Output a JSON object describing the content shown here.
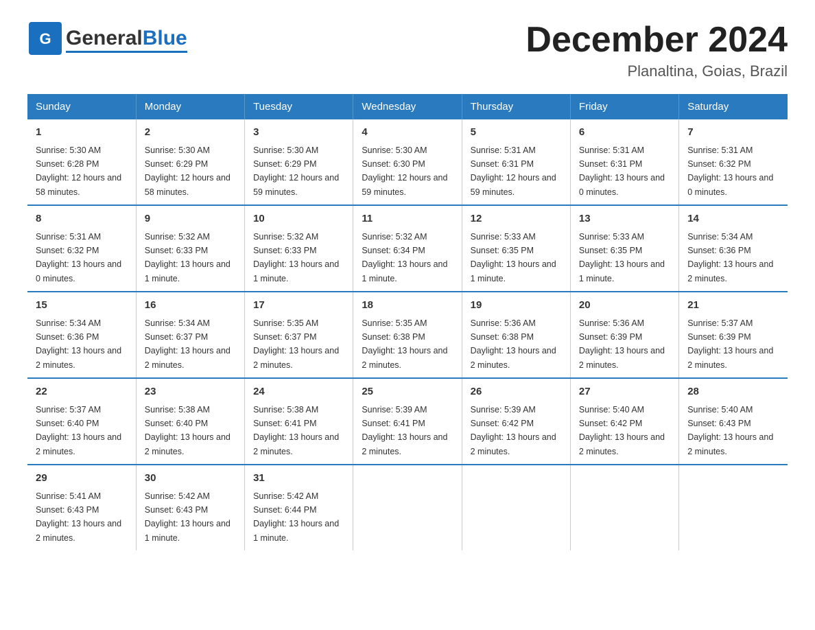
{
  "header": {
    "logo_text_general": "General",
    "logo_text_blue": "Blue",
    "title": "December 2024",
    "subtitle": "Planaltina, Goias, Brazil"
  },
  "days_of_week": [
    "Sunday",
    "Monday",
    "Tuesday",
    "Wednesday",
    "Thursday",
    "Friday",
    "Saturday"
  ],
  "weeks": [
    [
      {
        "day": "1",
        "sunrise": "5:30 AM",
        "sunset": "6:28 PM",
        "daylight": "12 hours and 58 minutes."
      },
      {
        "day": "2",
        "sunrise": "5:30 AM",
        "sunset": "6:29 PM",
        "daylight": "12 hours and 58 minutes."
      },
      {
        "day": "3",
        "sunrise": "5:30 AM",
        "sunset": "6:29 PM",
        "daylight": "12 hours and 59 minutes."
      },
      {
        "day": "4",
        "sunrise": "5:30 AM",
        "sunset": "6:30 PM",
        "daylight": "12 hours and 59 minutes."
      },
      {
        "day": "5",
        "sunrise": "5:31 AM",
        "sunset": "6:31 PM",
        "daylight": "12 hours and 59 minutes."
      },
      {
        "day": "6",
        "sunrise": "5:31 AM",
        "sunset": "6:31 PM",
        "daylight": "13 hours and 0 minutes."
      },
      {
        "day": "7",
        "sunrise": "5:31 AM",
        "sunset": "6:32 PM",
        "daylight": "13 hours and 0 minutes."
      }
    ],
    [
      {
        "day": "8",
        "sunrise": "5:31 AM",
        "sunset": "6:32 PM",
        "daylight": "13 hours and 0 minutes."
      },
      {
        "day": "9",
        "sunrise": "5:32 AM",
        "sunset": "6:33 PM",
        "daylight": "13 hours and 1 minute."
      },
      {
        "day": "10",
        "sunrise": "5:32 AM",
        "sunset": "6:33 PM",
        "daylight": "13 hours and 1 minute."
      },
      {
        "day": "11",
        "sunrise": "5:32 AM",
        "sunset": "6:34 PM",
        "daylight": "13 hours and 1 minute."
      },
      {
        "day": "12",
        "sunrise": "5:33 AM",
        "sunset": "6:35 PM",
        "daylight": "13 hours and 1 minute."
      },
      {
        "day": "13",
        "sunrise": "5:33 AM",
        "sunset": "6:35 PM",
        "daylight": "13 hours and 1 minute."
      },
      {
        "day": "14",
        "sunrise": "5:34 AM",
        "sunset": "6:36 PM",
        "daylight": "13 hours and 2 minutes."
      }
    ],
    [
      {
        "day": "15",
        "sunrise": "5:34 AM",
        "sunset": "6:36 PM",
        "daylight": "13 hours and 2 minutes."
      },
      {
        "day": "16",
        "sunrise": "5:34 AM",
        "sunset": "6:37 PM",
        "daylight": "13 hours and 2 minutes."
      },
      {
        "day": "17",
        "sunrise": "5:35 AM",
        "sunset": "6:37 PM",
        "daylight": "13 hours and 2 minutes."
      },
      {
        "day": "18",
        "sunrise": "5:35 AM",
        "sunset": "6:38 PM",
        "daylight": "13 hours and 2 minutes."
      },
      {
        "day": "19",
        "sunrise": "5:36 AM",
        "sunset": "6:38 PM",
        "daylight": "13 hours and 2 minutes."
      },
      {
        "day": "20",
        "sunrise": "5:36 AM",
        "sunset": "6:39 PM",
        "daylight": "13 hours and 2 minutes."
      },
      {
        "day": "21",
        "sunrise": "5:37 AM",
        "sunset": "6:39 PM",
        "daylight": "13 hours and 2 minutes."
      }
    ],
    [
      {
        "day": "22",
        "sunrise": "5:37 AM",
        "sunset": "6:40 PM",
        "daylight": "13 hours and 2 minutes."
      },
      {
        "day": "23",
        "sunrise": "5:38 AM",
        "sunset": "6:40 PM",
        "daylight": "13 hours and 2 minutes."
      },
      {
        "day": "24",
        "sunrise": "5:38 AM",
        "sunset": "6:41 PM",
        "daylight": "13 hours and 2 minutes."
      },
      {
        "day": "25",
        "sunrise": "5:39 AM",
        "sunset": "6:41 PM",
        "daylight": "13 hours and 2 minutes."
      },
      {
        "day": "26",
        "sunrise": "5:39 AM",
        "sunset": "6:42 PM",
        "daylight": "13 hours and 2 minutes."
      },
      {
        "day": "27",
        "sunrise": "5:40 AM",
        "sunset": "6:42 PM",
        "daylight": "13 hours and 2 minutes."
      },
      {
        "day": "28",
        "sunrise": "5:40 AM",
        "sunset": "6:43 PM",
        "daylight": "13 hours and 2 minutes."
      }
    ],
    [
      {
        "day": "29",
        "sunrise": "5:41 AM",
        "sunset": "6:43 PM",
        "daylight": "13 hours and 2 minutes."
      },
      {
        "day": "30",
        "sunrise": "5:42 AM",
        "sunset": "6:43 PM",
        "daylight": "13 hours and 1 minute."
      },
      {
        "day": "31",
        "sunrise": "5:42 AM",
        "sunset": "6:44 PM",
        "daylight": "13 hours and 1 minute."
      },
      null,
      null,
      null,
      null
    ]
  ],
  "labels": {
    "sunrise": "Sunrise:",
    "sunset": "Sunset:",
    "daylight": "Daylight:"
  }
}
